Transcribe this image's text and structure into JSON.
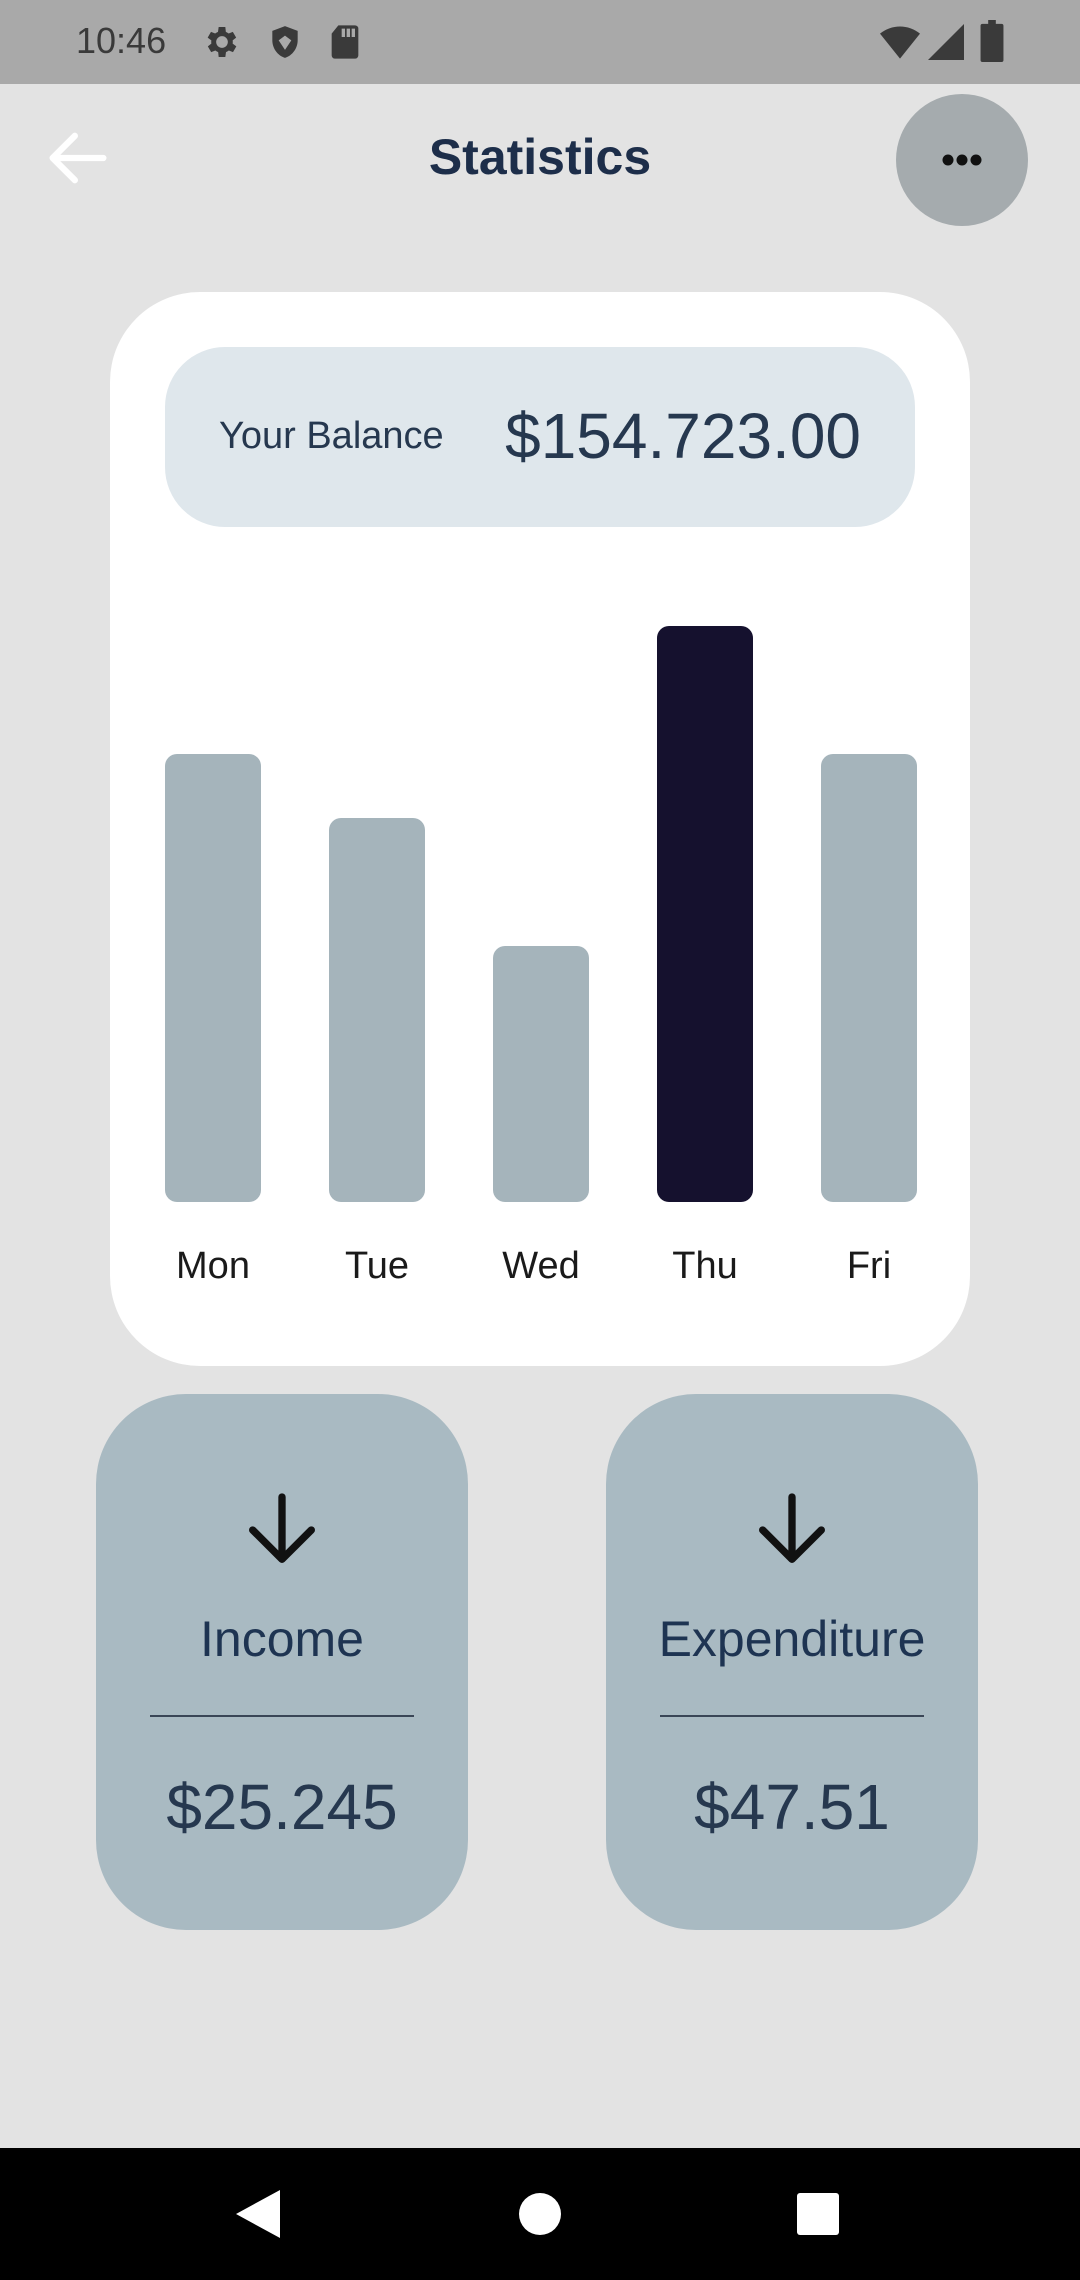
{
  "status_bar": {
    "time": "10:46",
    "left_icons": [
      "gear-icon",
      "shield-icon",
      "sd-card-icon"
    ],
    "right_icons": [
      "wifi-icon",
      "signal-icon",
      "battery-icon"
    ]
  },
  "app_bar": {
    "title": "Statistics",
    "back_icon": "arrow-back-icon",
    "more_icon": "more-horizontal-icon"
  },
  "balance": {
    "label": "Your Balance",
    "value": "$154.723.00"
  },
  "chart_data": {
    "type": "bar",
    "categories": [
      "Mon",
      "Tue",
      "Wed",
      "Thu",
      "Fri"
    ],
    "values": [
      7,
      6,
      4,
      9,
      7
    ],
    "highlight_index": 3,
    "colors": {
      "bar": "#a5b4bb",
      "highlight": "#15112e"
    },
    "ylim": [
      0,
      10
    ],
    "grid": false
  },
  "tiles": {
    "income": {
      "title": "Income",
      "value": "$25.245",
      "icon": "arrow-down-icon"
    },
    "expenditure": {
      "title": "Expenditure",
      "value": "$47.51",
      "icon": "arrow-down-icon"
    }
  },
  "nav_bar": {
    "back": "nav-back-icon",
    "home": "nav-home-icon",
    "recents": "nav-recents-icon"
  },
  "colors": {
    "background": "#e3e3e3",
    "card": "#ffffff",
    "tile": "#a9bac2",
    "title_text": "#1d2e4a"
  }
}
